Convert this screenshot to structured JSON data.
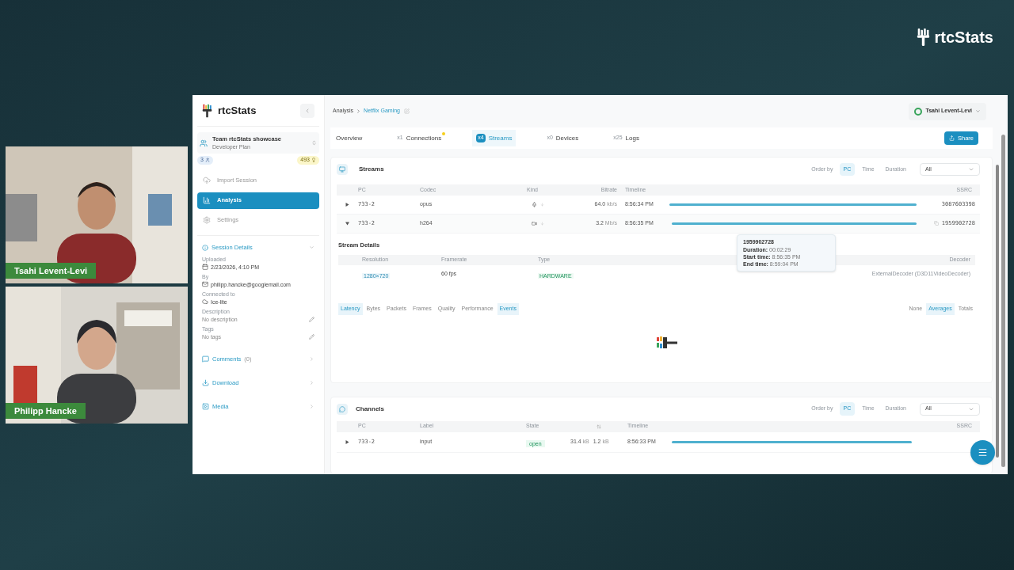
{
  "brand": {
    "name": "rtcStats"
  },
  "participants": [
    {
      "name": "Tsahi Levent-Levi"
    },
    {
      "name": "Philipp Hancke"
    }
  ],
  "sidebar": {
    "brand": "rtcStats",
    "team": {
      "name": "Team rtcStats showcase",
      "plan": "Developer Plan"
    },
    "members": "3",
    "credits": "493",
    "nav": [
      {
        "label": "Import Session",
        "kind": "import",
        "selected": false
      },
      {
        "label": "Analysis",
        "kind": "analysis",
        "selected": true
      },
      {
        "label": "Settings",
        "kind": "settings",
        "selected": false
      }
    ],
    "session_details": {
      "title": "Session Details",
      "expanded": true,
      "fields": [
        {
          "label": "Uploaded",
          "value": "2/23/2026, 4:10 PM",
          "kind": "date"
        },
        {
          "label": "By",
          "value": "philipp.hancke@googlemail.com",
          "kind": "email"
        },
        {
          "label": "Connected to",
          "value": "Ice-lite",
          "kind": "connection"
        },
        {
          "label": "Description",
          "value": "No description",
          "kind": "editable"
        },
        {
          "label": "Tags",
          "value": "No tags",
          "kind": "editable"
        }
      ]
    },
    "sections": [
      {
        "label": "Comments",
        "count": "(0)",
        "kind": "comments"
      },
      {
        "label": "Download",
        "kind": "download"
      },
      {
        "label": "Media",
        "kind": "media"
      }
    ]
  },
  "breadcrumb": {
    "parent": "Analysis",
    "current": "Netflix Gaming"
  },
  "user": {
    "name": "Tsahi Levent-Levi"
  },
  "tabs": [
    {
      "label": "Overview",
      "selected": false,
      "alert": false
    },
    {
      "count": "x1",
      "label": "Connections",
      "selected": false,
      "alert": true
    },
    {
      "count": "x4",
      "label": "Streams",
      "selected": true,
      "alert": false
    },
    {
      "count": "x0",
      "label": "Devices",
      "selected": false,
      "alert": false
    },
    {
      "count": "x25",
      "label": "Logs",
      "selected": false,
      "alert": false
    }
  ],
  "share": "Share",
  "streams": {
    "title": "Streams",
    "order_label": "Order by",
    "order": [
      {
        "label": "PC",
        "selected": true
      },
      {
        "label": "Time",
        "selected": false
      },
      {
        "label": "Duration",
        "selected": false
      }
    ],
    "filter": "All",
    "columns": [
      "PC",
      "Codec",
      "Kind",
      "Bitrate",
      "Timeline",
      "SSRC"
    ],
    "rows": [
      {
        "expanded": false,
        "pc": "733-2",
        "codec": "opus",
        "kind": "audio",
        "bitrate": "64.0",
        "unit": "kb/s",
        "time": "8:56:34 PM",
        "ssrc": "3087603398",
        "copy_icon": false
      },
      {
        "expanded": true,
        "pc": "733-2",
        "codec": "h264",
        "kind": "video",
        "bitrate": "3.2",
        "unit": "Mb/s",
        "time": "8:56:35 PM",
        "ssrc": "1959902728",
        "copy_icon": true
      }
    ],
    "details": {
      "title": "Stream Details",
      "columns": [
        "Resolution",
        "Framerate",
        "Type",
        "Decoder"
      ],
      "resolution": "1280×720",
      "framerate": "60 fps",
      "type": "HARDWARE",
      "decoder": "ExternalDecoder (D3D11VideoDecoder)"
    },
    "metric_tabs": [
      {
        "label": "Latency",
        "selected": true
      },
      {
        "label": "Bytes",
        "selected": false
      },
      {
        "label": "Packets",
        "selected": false
      },
      {
        "label": "Frames",
        "selected": false
      },
      {
        "label": "Quality",
        "selected": false
      },
      {
        "label": "Performance",
        "selected": false
      },
      {
        "label": "Events",
        "selected": true
      }
    ],
    "aggregations": [
      {
        "label": "None",
        "selected": false
      },
      {
        "label": "Averages",
        "selected": true
      },
      {
        "label": "Totals",
        "selected": false
      }
    ],
    "tooltip": {
      "title": "1959902728",
      "lines": [
        {
          "label": "Duration:",
          "value": "00:02:29"
        },
        {
          "label": "Start time:",
          "value": "8:56:35 PM"
        },
        {
          "label": "End time:",
          "value": "8:59:04 PM"
        }
      ]
    }
  },
  "channels": {
    "title": "Channels",
    "order_label": "Order by",
    "order": [
      {
        "label": "PC",
        "selected": true
      },
      {
        "label": "Time",
        "selected": false
      },
      {
        "label": "Duration",
        "selected": false
      }
    ],
    "filter": "All",
    "columns": [
      "PC",
      "Label",
      "State",
      "Timeline",
      "SSRC"
    ],
    "rows": [
      {
        "expanded": false,
        "pc": "733-2",
        "label": "input",
        "state": "open",
        "sent": "31.4",
        "sent_unit": "kB",
        "received": "1.2",
        "received_unit": "kB",
        "time": "8:56:33 PM"
      }
    ]
  }
}
